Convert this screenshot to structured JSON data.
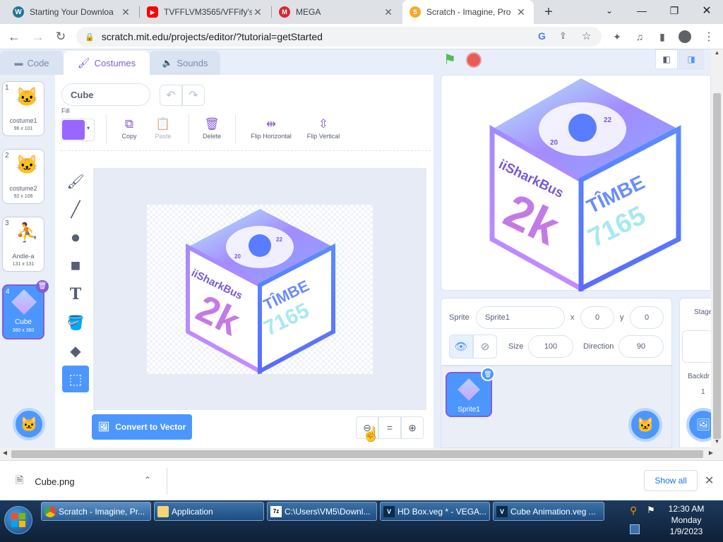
{
  "browser": {
    "tabs": [
      {
        "title": "Starting Your Downloa",
        "icon": "wordpress-icon",
        "color": "#21759b",
        "active": false
      },
      {
        "title": "TVFFLVM3565/VFFify's",
        "icon": "youtube-icon",
        "color": "#ff0000",
        "active": false
      },
      {
        "title": "MEGA",
        "icon": "mega-icon",
        "color": "#d9272e",
        "active": false
      },
      {
        "title": "Scratch - Imagine, Pro",
        "icon": "scratch-icon",
        "color": "#f9a825",
        "active": true
      }
    ],
    "url": "scratch.mit.edu/projects/editor/?tutorial=getStarted"
  },
  "editor": {
    "tabs": {
      "code": "Code",
      "costumes": "Costumes",
      "sounds": "Sounds"
    },
    "costumes": [
      {
        "num": "1",
        "name": "costume1",
        "size": "96 x 101"
      },
      {
        "num": "2",
        "name": "costume2",
        "size": "92 x 106"
      },
      {
        "num": "3",
        "name": "Andie-a",
        "size": "131 x 131"
      },
      {
        "num": "4",
        "name": "Cube",
        "size": "360 x 360"
      }
    ],
    "paint": {
      "costume_name": "Cube",
      "fill_label": "Fill",
      "fill_color": "#9966ff",
      "copy": "Copy",
      "paste": "Paste",
      "delete": "Delete",
      "flip_h": "Flip Horizontal",
      "flip_v": "Flip Vertical",
      "convert": "Convert to Vector"
    },
    "cube_art": {
      "left_text": "iiSharkBus",
      "left_big": "2k",
      "right_text": "TÎMBE",
      "right_num": "7165",
      "badge_top": "22",
      "badge_bottom": "20"
    }
  },
  "sprite_info": {
    "sprite_label": "Sprite",
    "sprite_name": "Sprite1",
    "x_label": "x",
    "x": "0",
    "y_label": "y",
    "y": "0",
    "show_label": "Show",
    "size_label": "Size",
    "size": "100",
    "direction_label": "Direction",
    "direction": "90",
    "sprite_tile": "Sprite1"
  },
  "stage_panel": {
    "label": "Stage",
    "backdrops_label": "Backdr",
    "backdrops_count": "1"
  },
  "download": {
    "file": "Cube.png",
    "show_all": "Show all"
  },
  "taskbar": {
    "items": [
      {
        "label": "Scratch - Imagine, Pr...",
        "icon": "chrome-icon"
      },
      {
        "label": "Application",
        "icon": "folder-icon"
      },
      {
        "label": "C:\\Users\\VM5\\Downl...",
        "icon": "cmd-icon"
      },
      {
        "label": "HD Box.veg * - VEGA...",
        "icon": "vegas-icon"
      },
      {
        "label": "Cube Animation.veg ...",
        "icon": "vegas-icon"
      }
    ],
    "time": "12:30 AM",
    "day": "Monday",
    "date": "1/9/2023"
  }
}
